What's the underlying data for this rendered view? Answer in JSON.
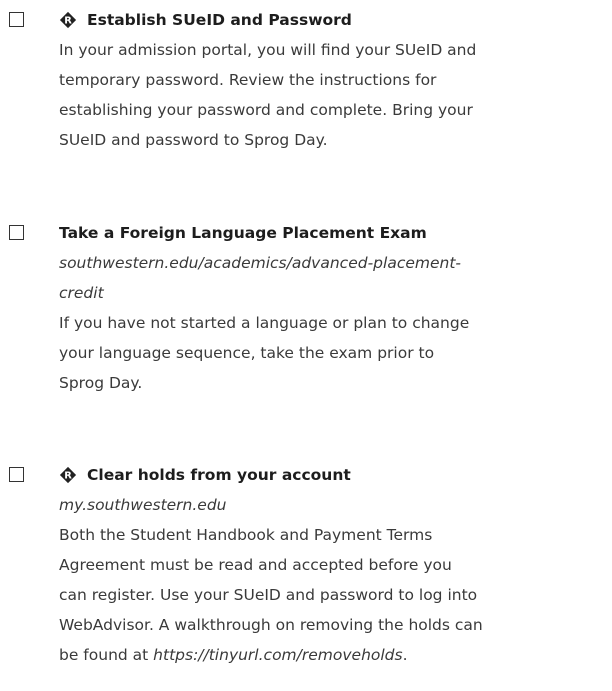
{
  "items": [
    {
      "title": "Establish SUeID and Password",
      "required_icon": "required-r-diamond-icon",
      "body_lines": [
        "In your admission portal, you will find your SUeID and",
        "temporary password. Review the instructions for",
        "establishing your password and complete. Bring your",
        "SUeID and password to Sprog Day."
      ]
    },
    {
      "title": "Take a Foreign Language Placement Exam",
      "link_lines": [
        "southwestern.edu/academics/advanced-placement-",
        "credit"
      ],
      "body_lines": [
        "If you have not started a language or plan to change",
        "your language sequence, take the exam prior to",
        "Sprog Day."
      ]
    },
    {
      "title": "Clear holds from your account",
      "required_icon": "required-r-diamond-icon",
      "link": "my.southwestern.edu",
      "body_lines": [
        "Both the Student Handbook and Payment Terms",
        "Agreement must be read and accepted before you",
        "can register. Use your SUeID and password to log into",
        "WebAdvisor. A walkthrough on removing the holds can"
      ],
      "last_line_prefix": "be found at ",
      "last_line_link": "https://tinyurl.com/removeholds",
      "last_line_suffix": "."
    }
  ],
  "colors": {
    "text": "#3a3a3a",
    "title": "#1d1d1d",
    "icon": "#222222"
  }
}
